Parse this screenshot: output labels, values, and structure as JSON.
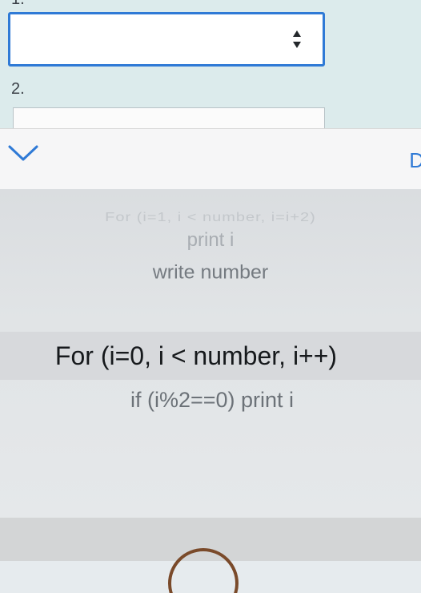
{
  "form": {
    "q1_label": "1.",
    "q2_label": "2."
  },
  "toolbar": {
    "done_label": "D"
  },
  "picker": {
    "options": [
      "For (i=1, i < number, i=i+2)",
      "print i",
      "write number",
      "For (i=0, i < number, i++)",
      "if (i%2==0) print i"
    ],
    "selected_index": 3
  },
  "colors": {
    "accent": "#2f7ad6"
  }
}
